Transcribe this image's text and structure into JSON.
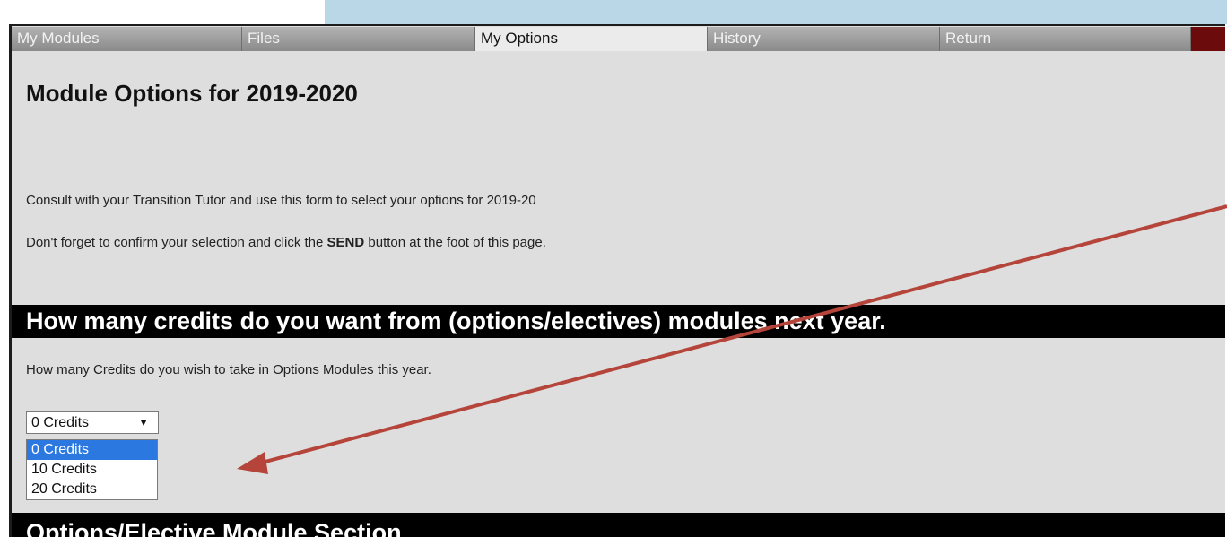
{
  "tabs": [
    {
      "label": "My Modules"
    },
    {
      "label": "Files"
    },
    {
      "label": "My Options",
      "active": true
    },
    {
      "label": "History"
    },
    {
      "label": "Return"
    }
  ],
  "page_title": "Module Options for 2019-2020",
  "intro": {
    "line1": "Consult with your Transition Tutor and use this form to select your options for 2019-20",
    "line2_before": "Don't forget to confirm your selection and click the ",
    "line2_bold": "SEND",
    "line2_after": " button at the foot of this page."
  },
  "credits_section": {
    "heading": "How many credits do you want from (options/electives) modules next year.",
    "question": "How many Credits do you wish to take in Options Modules this year."
  },
  "credits_select": {
    "selected": "0 Credits",
    "options": [
      "0 Credits",
      "10 Credits",
      "20 Credits"
    ],
    "highlighted_index": 0
  },
  "next_section": {
    "heading": "Options/Elective Module Section"
  },
  "colors": {
    "annotation_arrow": "#b5443a",
    "tab_end_marker": "#6b0b0b",
    "highlight": "#2b78e0",
    "top_strip": "#b9d7e6"
  },
  "icons": [
    "dropdown-arrow-icon",
    "annotation-arrow"
  ]
}
